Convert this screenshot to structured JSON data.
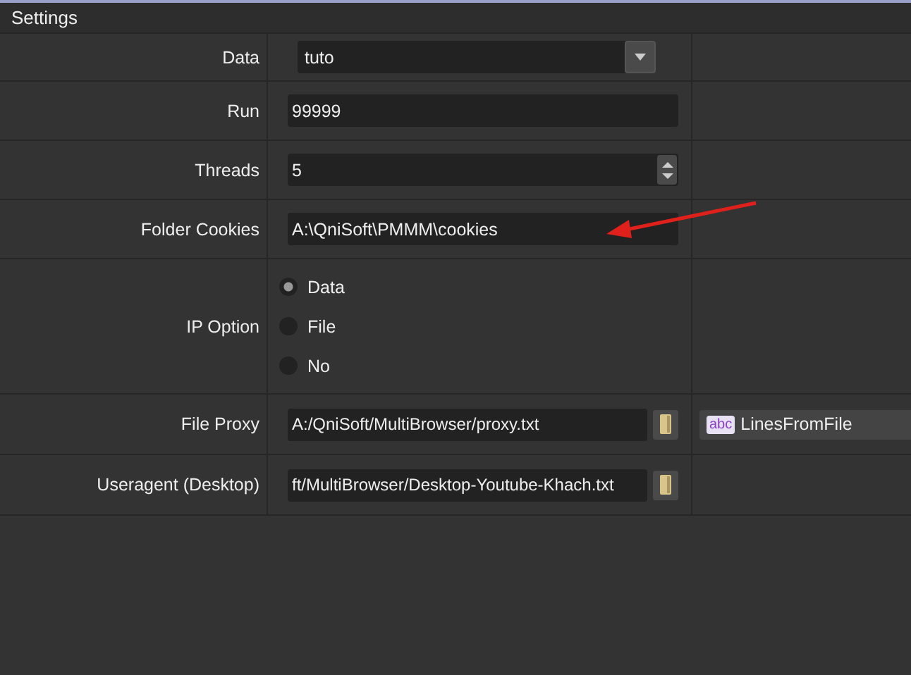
{
  "window": {
    "title": "Settings"
  },
  "rows": [
    {
      "label": "Data",
      "kind": "select",
      "value": "tuto"
    },
    {
      "label": "Run",
      "kind": "text",
      "value": "99999"
    },
    {
      "label": "Threads",
      "kind": "spin",
      "value": "5"
    },
    {
      "label": "Folder Cookies",
      "kind": "text",
      "value": "A:\\QniSoft\\PMMM\\cookies"
    },
    {
      "label": "IP Option",
      "kind": "radio",
      "options": [
        {
          "label": "Data",
          "selected": true
        },
        {
          "label": "File",
          "selected": false
        },
        {
          "label": "No",
          "selected": false
        }
      ]
    },
    {
      "label": "File Proxy",
      "kind": "file",
      "value": "A:/QniSoft/MultiBrowser/proxy.txt",
      "mode": {
        "tag": "abc",
        "label": "LinesFromFile"
      }
    },
    {
      "label": "Useragent (Desktop)",
      "kind": "file",
      "value": "ft/MultiBrowser/Desktop-Youtube-Khach.txt"
    }
  ]
}
